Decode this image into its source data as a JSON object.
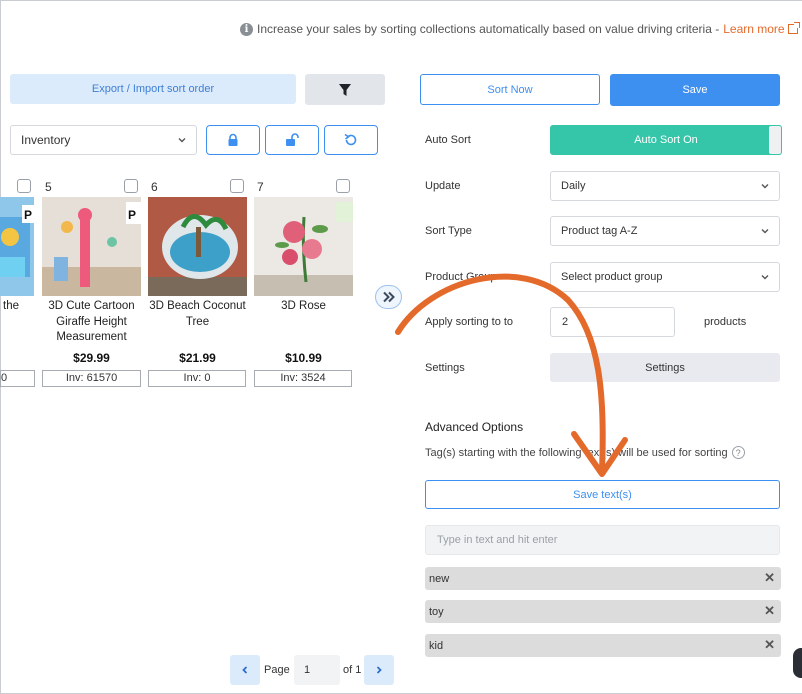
{
  "info_bar": {
    "text": "Increase your sales by sorting collections automatically based on value driving criteria -",
    "link": "Learn more"
  },
  "left_panel": {
    "export_label": "Export / Import sort order",
    "sort_select_value": "Inventory",
    "products": [
      {
        "num": "",
        "title": "the",
        "price": "",
        "inv": "0"
      },
      {
        "num": "5",
        "title": "3D Cute Cartoon Giraffe Height Measurement",
        "price": "$29.99",
        "inv": "Inv: 61570"
      },
      {
        "num": "6",
        "title": "3D Beach Coconut Tree",
        "price": "$21.99",
        "inv": "Inv: 0"
      },
      {
        "num": "7",
        "title": "3D Rose",
        "price": "$10.99",
        "inv": "Inv: 3524"
      }
    ],
    "pagination": {
      "page_label": "Page",
      "page_value": "1",
      "of_label": "of 1"
    }
  },
  "right_panel": {
    "sort_now_label": "Sort Now",
    "save_label": "Save",
    "auto_sort": {
      "label": "Auto Sort",
      "value": "Auto Sort On"
    },
    "update": {
      "label": "Update",
      "value": "Daily"
    },
    "sort_type": {
      "label": "Sort Type",
      "value": "Product tag A-Z"
    },
    "product_group": {
      "label": "Product Group",
      "value": "Select product group"
    },
    "apply_sorting": {
      "label": "Apply sorting to to",
      "value": "2",
      "suffix": "products"
    },
    "settings": {
      "label": "Settings",
      "button": "Settings"
    },
    "advanced": {
      "title": "Advanced Options",
      "help": "Tag(s) starting with the following text(s) will be used for sorting",
      "save_texts_label": "Save text(s)",
      "input_placeholder": "Type in text and hit enter",
      "tags": [
        "new",
        "toy",
        "kid"
      ]
    }
  },
  "colors": {
    "accent": "#3d8ff0",
    "toggle_on": "#35c5a8",
    "annotation_arrow": "#e46a2b"
  }
}
